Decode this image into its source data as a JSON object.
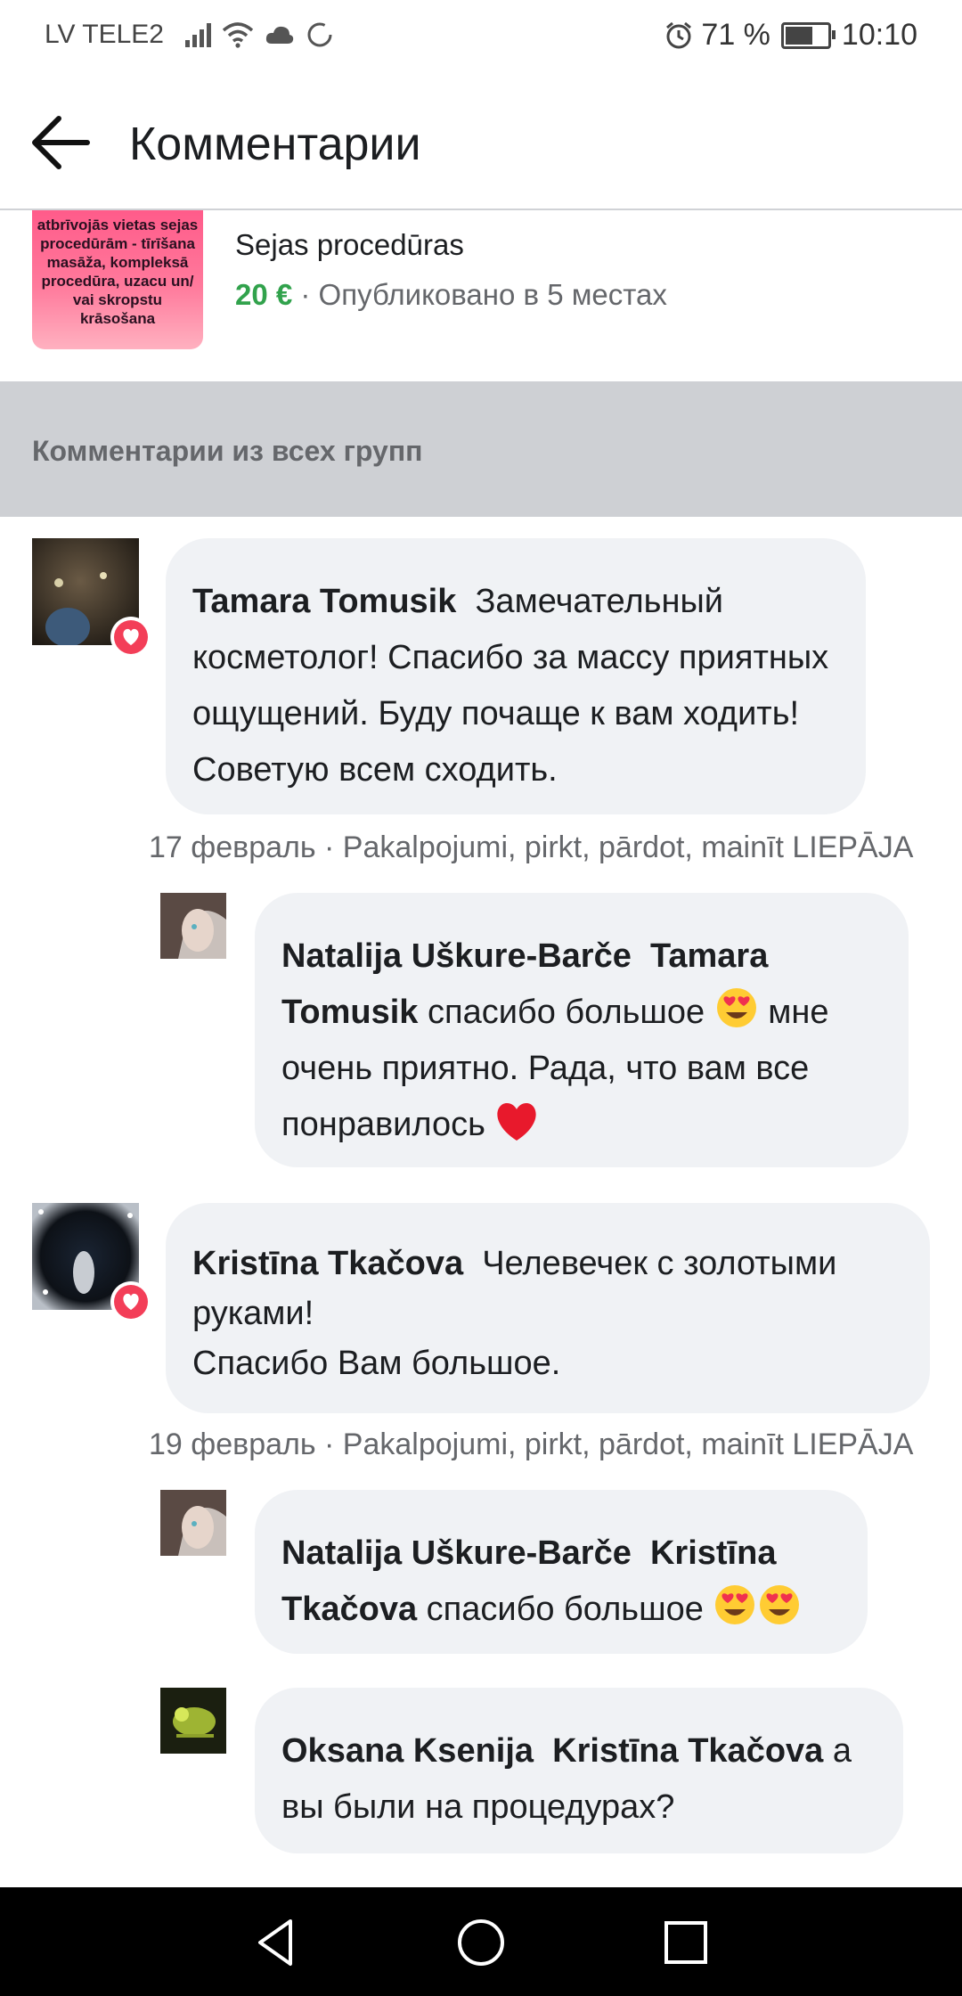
{
  "status_bar": {
    "carrier": "LV TELE2",
    "battery": "71 %",
    "battery_level": 0.71,
    "time": "10:10"
  },
  "header": {
    "title": "Комментарии",
    "back_icon": "arrow-left-icon"
  },
  "product": {
    "thumbnail_text": "atbrīvojās vietas sejas procedūrām - tīrīšana masāža, kompleksā procedūra, uzacu un/ vai skropstu krāsošana",
    "name": "Sejas procedūras",
    "price": "20 €",
    "meta": " · Опубликовано в 5 местах"
  },
  "section": {
    "title": "Комментарии из всех групп"
  },
  "comments": [
    {
      "author": "Tamara Tomusik",
      "text": "Замечательный косметолог! Спасибо за массу приятных ощущений. Буду почаще к вам ходить!Советую всем сходить.",
      "meta": "17 февраль · Pakalpojumi, pirkt, pārdot, mainīt LIEPĀJA",
      "reaction": "love-icon",
      "replies": [
        {
          "author": "Natalija Uškure-Barče",
          "mention": "Tamara Tomusik",
          "text_a": " спасибо большое ",
          "text_b": " мне очень приятно. Рада, что вам все понравилось "
        }
      ]
    },
    {
      "author": "Kristīna Tkačova",
      "text_line1": "Челевечек с золотыми руками!",
      "text_line2": "Спасибо Вам большое.",
      "meta": "19 февраль · Pakalpojumi, pirkt, pārdot, mainīt LIEPĀJA",
      "reaction": "love-icon",
      "replies": [
        {
          "author": "Natalija Uškure-Barče",
          "mention": "Kristīna Tkačova",
          "text": " спасибо большое "
        },
        {
          "author": "Oksana Ksenija",
          "mention": "Kristīna Tkačova",
          "text": " а вы были на процедурах?"
        }
      ]
    }
  ],
  "nav": {
    "back": "triangle-back-icon",
    "home": "circle-home-icon",
    "recents": "square-recents-icon"
  }
}
